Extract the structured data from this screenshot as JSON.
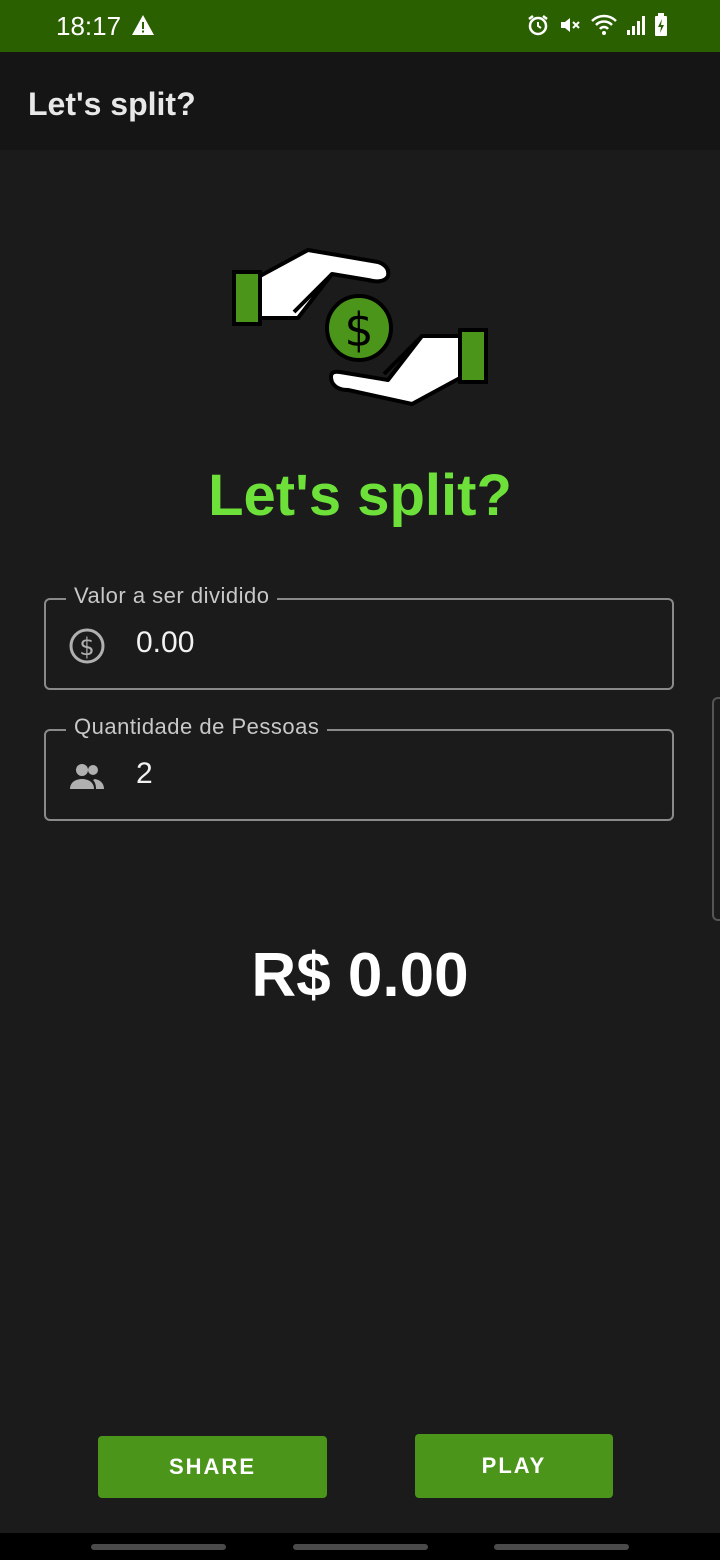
{
  "status_bar": {
    "time": "18:17"
  },
  "app_bar": {
    "title": "Let's split?"
  },
  "heading": "Let's split?",
  "fields": {
    "amount": {
      "label": "Valor a ser dividido",
      "value": "0.00"
    },
    "people": {
      "label": "Quantidade de Pessoas",
      "value": "2"
    }
  },
  "result": "R$ 0.00",
  "buttons": {
    "share": "SHARE",
    "play": "PLAY"
  },
  "colors": {
    "accent": "#6ee03a",
    "status_bar": "#2b6001",
    "button": "#4c951b",
    "background": "#1b1b1b"
  }
}
